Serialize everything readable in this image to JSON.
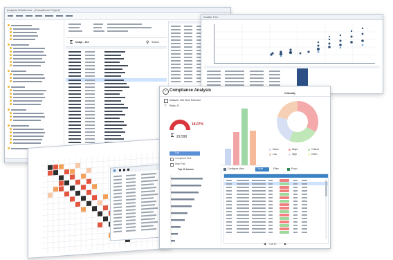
{
  "back_window": {
    "title": "Analysis Workbench - [Compliance Project]",
    "search_label": "Search",
    "grid_header": "Usage - 216"
  },
  "scatter_window": {
    "title": "Scatter Plot"
  },
  "compliance_window": {
    "title": "Compliance Analysis",
    "option_1": "Malware: 260 More Relevant",
    "option_2": "Risks: 97",
    "gauge_value": "18.07%",
    "count_value": "29,590",
    "legend_items": [
      "Low",
      "Compliant Risk",
      "High Risk"
    ],
    "top_title": "Top 10 Issues",
    "pie_title": "Criticality",
    "pie_legend": [
      "Minor",
      "Major",
      "Critical",
      "Low",
      "High",
      "Other"
    ],
    "toolbar_labels": [
      "Configure View",
      "Count",
      "Filter",
      "Excel"
    ],
    "pager": "1 of 17"
  },
  "colors": {
    "accent": "#3b82c4",
    "gauge_red": "#d9363e",
    "badge_red": "#f08080",
    "badge_green": "#9ed99b"
  }
}
